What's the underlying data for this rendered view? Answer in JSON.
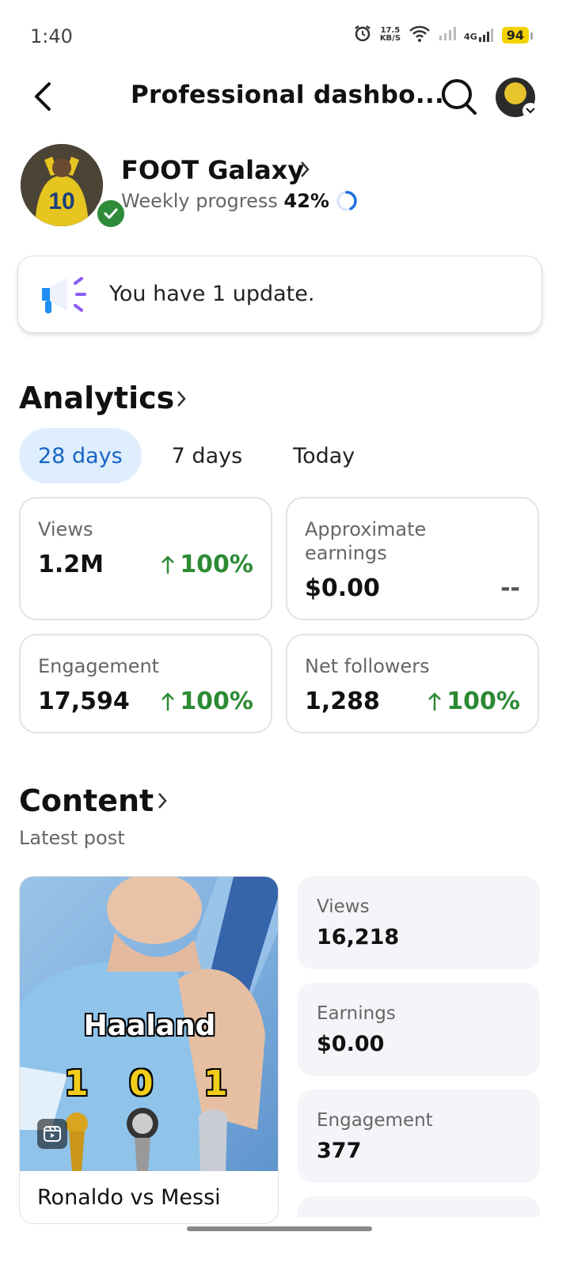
{
  "status_bar": {
    "time": "1:40",
    "net_speed_top": "17.5",
    "net_speed_bottom": "KB/S",
    "network": "4G",
    "battery": "94"
  },
  "header": {
    "title": "Professional dashbo..."
  },
  "profile": {
    "name": "FOOT Galaxy",
    "progress_label": "Weekly progress",
    "progress_value": "42%",
    "progress_fraction": 0.42
  },
  "update": {
    "text": "You have 1 update."
  },
  "analytics": {
    "title": "Analytics",
    "tabs": [
      "28 days",
      "7 days",
      "Today"
    ],
    "active_tab": "28 days",
    "cards": [
      {
        "label": "Views",
        "value": "1.2M",
        "change": "100%"
      },
      {
        "label": "Approximate earnings",
        "value": "$0.00",
        "change": "--"
      },
      {
        "label": "Engagement",
        "value": "17,594",
        "change": "100%"
      },
      {
        "label": "Net followers",
        "value": "1,288",
        "change": "100%"
      }
    ]
  },
  "content": {
    "title": "Content",
    "subtitle": "Latest post",
    "post": {
      "thumb_title": "Haaland",
      "scores": [
        "1",
        "0",
        "1"
      ],
      "caption": "Ronaldo vs Messi"
    },
    "stats": [
      {
        "label": "Views",
        "value": "16,218"
      },
      {
        "label": "Earnings",
        "value": "$0.00"
      },
      {
        "label": "Engagement",
        "value": "377"
      }
    ]
  },
  "colors": {
    "accent_blue": "#1765c4",
    "tab_active_bg": "#dfeefd",
    "positive_green": "#2c8a34",
    "verified_green": "#2e8b3a",
    "battery_yellow": "#f4d200"
  }
}
